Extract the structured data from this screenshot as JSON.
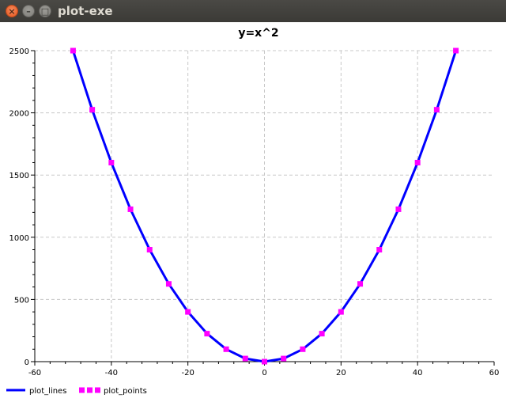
{
  "window": {
    "title": "plot-exe"
  },
  "chart_data": {
    "type": "line",
    "title": "y=x^2",
    "xlabel": "",
    "ylabel": "",
    "xlim": [
      -60,
      60
    ],
    "ylim": [
      0,
      2500
    ],
    "x_ticks": [
      -60,
      -40,
      -20,
      0,
      20,
      40,
      60
    ],
    "y_ticks": [
      0,
      500,
      1000,
      1500,
      2000,
      2500
    ],
    "grid": true,
    "legend_placement": "bottom-left",
    "series": [
      {
        "name": "plot_lines",
        "style": "line",
        "color": "#0000ff",
        "x": [
          -50,
          -45,
          -40,
          -35,
          -30,
          -25,
          -20,
          -15,
          -10,
          -5,
          0,
          5,
          10,
          15,
          20,
          25,
          30,
          35,
          40,
          45,
          50
        ],
        "y": [
          2500,
          2025,
          1600,
          1225,
          900,
          625,
          400,
          225,
          100,
          25,
          0,
          25,
          100,
          225,
          400,
          625,
          900,
          1225,
          1600,
          2025,
          2500
        ]
      },
      {
        "name": "plot_points",
        "style": "points",
        "color": "#ff00ff",
        "x": [
          -50,
          -45,
          -40,
          -35,
          -30,
          -25,
          -20,
          -15,
          -10,
          -5,
          0,
          5,
          10,
          15,
          20,
          25,
          30,
          35,
          40,
          45,
          50
        ],
        "y": [
          2500,
          2025,
          1600,
          1225,
          900,
          625,
          400,
          225,
          100,
          25,
          0,
          25,
          100,
          225,
          400,
          625,
          900,
          1225,
          1600,
          2025,
          2500
        ]
      }
    ]
  }
}
